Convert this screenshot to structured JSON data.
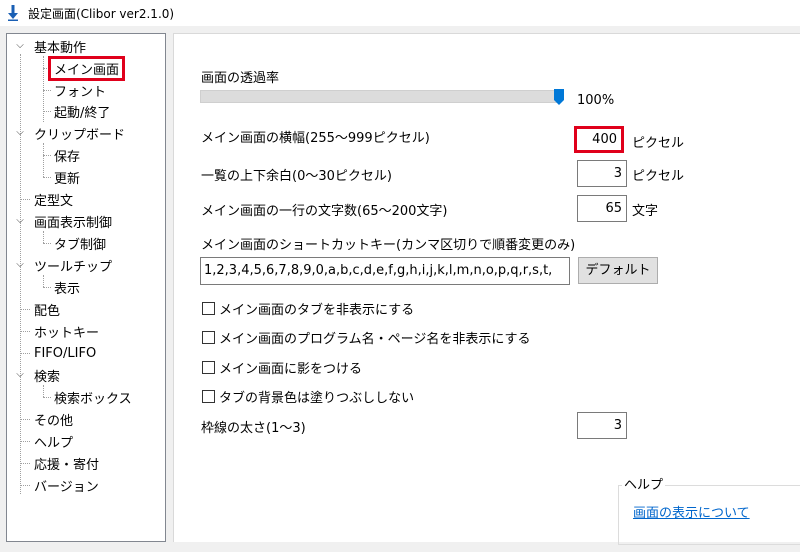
{
  "window": {
    "title": "設定画面(Clibor ver2.1.0)",
    "icon": "download-arrow-icon",
    "accent": "#1a5fb4"
  },
  "tree": {
    "items": [
      {
        "label": "基本動作",
        "expanded": true
      },
      {
        "label": "メイン画面",
        "selected": true
      },
      {
        "label": "フォント"
      },
      {
        "label": "起動/終了"
      },
      {
        "label": "クリップボード",
        "expanded": true
      },
      {
        "label": "保存"
      },
      {
        "label": "更新"
      },
      {
        "label": "定型文"
      },
      {
        "label": "画面表示制御",
        "expanded": true
      },
      {
        "label": "タブ制御"
      },
      {
        "label": "ツールチップ",
        "expanded": true
      },
      {
        "label": "表示"
      },
      {
        "label": "配色"
      },
      {
        "label": "ホットキー"
      },
      {
        "label": "FIFO/LIFO"
      },
      {
        "label": "検索",
        "expanded": true
      },
      {
        "label": "検索ボックス"
      },
      {
        "label": "その他"
      },
      {
        "label": "ヘルプ"
      },
      {
        "label": "応援・寄付"
      },
      {
        "label": "バージョン"
      }
    ],
    "highlight_color": "#e0001b"
  },
  "main": {
    "opacity": {
      "label": "画面の透過率",
      "value_text": "100%",
      "value": 1.0
    },
    "width": {
      "label": "メイン画面の横幅(255～999ピクセル)",
      "value": "400",
      "unit": "ピクセル"
    },
    "margin": {
      "label": "一覧の上下余白(0～30ピクセル)",
      "value": "3",
      "unit": "ピクセル"
    },
    "chars": {
      "label": "メイン画面の一行の文字数(65～200文字)",
      "value": "65",
      "unit": "文字"
    },
    "shortcut": {
      "label": "メイン画面のショートカットキー(カンマ区切りで順番変更のみ)",
      "value": "1,2,3,4,5,6,7,8,9,0,a,b,c,d,e,f,g,h,i,j,k,l,m,n,o,p,q,r,s,t,",
      "default_button": "デフォルト"
    },
    "checkboxes": [
      {
        "label": "メイン画面のタブを非表示にする",
        "checked": false
      },
      {
        "label": "メイン画面のプログラム名・ページ名を非表示にする",
        "checked": false
      },
      {
        "label": "メイン画面に影をつける",
        "checked": false
      },
      {
        "label": "タブの背景色は塗りつぶししない",
        "checked": false
      }
    ],
    "border": {
      "label": "枠線の太さ(1～3)",
      "value": "3"
    },
    "help": {
      "title": "ヘルプ",
      "link": "画面の表示について"
    }
  }
}
